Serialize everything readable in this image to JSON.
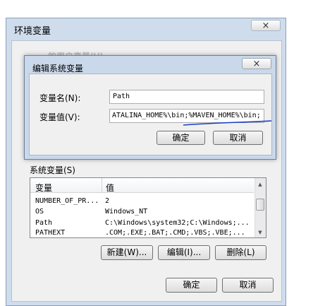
{
  "outer_window": {
    "title": "环境变量",
    "blurred_text": "…的用户变量(U)",
    "close_icon": "×",
    "system_vars_label": "系统变量(S)",
    "table_headers": [
      "变量",
      "值"
    ],
    "rows": [
      {
        "name": "NUMBER_OF_PR...",
        "value": "2"
      },
      {
        "name": "OS",
        "value": "Windows_NT"
      },
      {
        "name": "Path",
        "value": "C:\\Windows\\system32;C:\\Windows;..."
      },
      {
        "name": "PATHEXT",
        "value": ".COM;.EXE;.BAT;.CMD;.VBS;.VBE;..."
      }
    ],
    "new_button": "新建(W)...",
    "edit_button": "编辑(I)...",
    "delete_button": "删除(L)",
    "ok_button": "确定",
    "cancel_button": "取消"
  },
  "edit_dialog": {
    "title": "编辑系统变量",
    "close_icon": "×",
    "name_label": "变量名(N):",
    "name_value": "Path",
    "value_label": "变量值(V):",
    "value_value": "ATALINA_HOME%\\bin;%MAVEN_HOME%\\bin;",
    "ok_button": "确定",
    "cancel_button": "取消"
  },
  "colors": {
    "annotation_underline": "#1a3fbf",
    "window_frame": "#c9d8ea",
    "selected_row": "#ffffff"
  }
}
